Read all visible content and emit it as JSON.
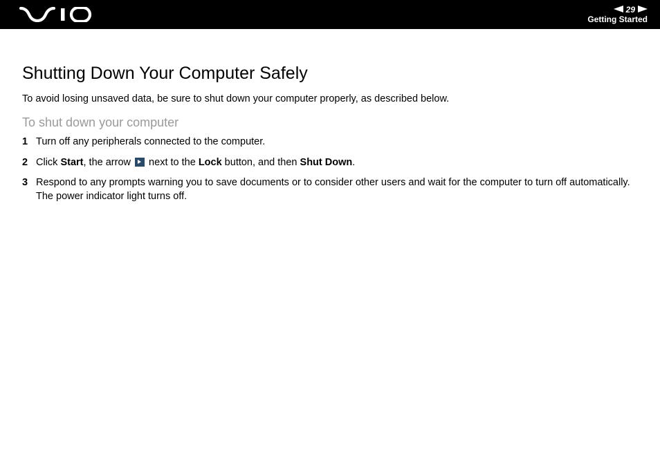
{
  "header": {
    "page_number": "29",
    "section": "Getting Started"
  },
  "title": "Shutting Down Your Computer Safely",
  "intro": "To avoid losing unsaved data, be sure to shut down your computer properly, as described below.",
  "subheading": "To shut down your computer",
  "steps": {
    "s1": "Turn off any peripherals connected to the computer.",
    "s2a": "Click ",
    "s2b": "Start",
    "s2c": ", the arrow ",
    "s2d": " next to the ",
    "s2e": "Lock",
    "s2f": " button, and then ",
    "s2g": "Shut Down",
    "s2h": ".",
    "s3a": "Respond to any prompts warning you to save documents or to consider other users and wait for the computer to turn off automatically.",
    "s3b": "The power indicator light turns off."
  }
}
